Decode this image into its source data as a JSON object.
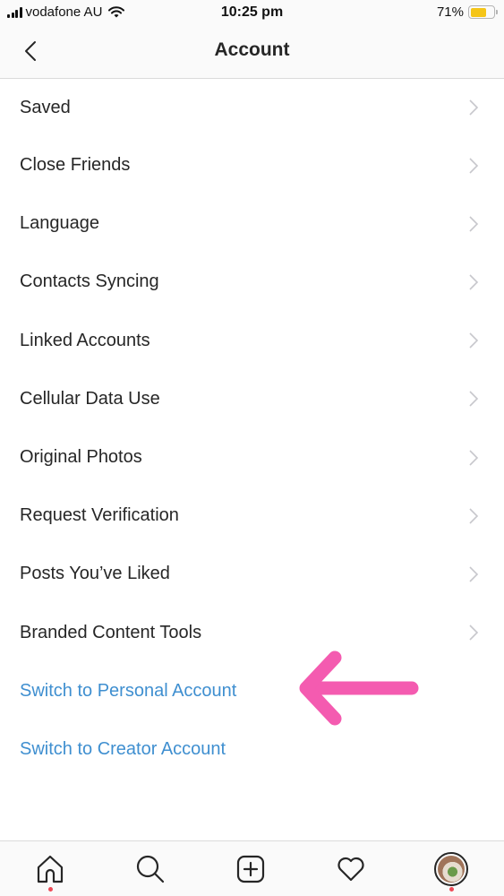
{
  "status_bar": {
    "carrier": "vodafone AU",
    "time": "10:25 pm",
    "battery_percent": "71%",
    "battery_level": 0.71,
    "battery_color": "#f5c518",
    "icons": [
      "signal-icon",
      "wifi-icon",
      "battery-icon"
    ]
  },
  "header": {
    "title": "Account",
    "back_icon": "chevron-left-icon"
  },
  "menu": {
    "items": [
      {
        "label": "Saved",
        "type": "nav"
      },
      {
        "label": "Close Friends",
        "type": "nav"
      },
      {
        "label": "Language",
        "type": "nav"
      },
      {
        "label": "Contacts Syncing",
        "type": "nav"
      },
      {
        "label": "Linked Accounts",
        "type": "nav"
      },
      {
        "label": "Cellular Data Use",
        "type": "nav"
      },
      {
        "label": "Original Photos",
        "type": "nav"
      },
      {
        "label": "Request Verification",
        "type": "nav"
      },
      {
        "label": "Posts You’ve Liked",
        "type": "nav"
      },
      {
        "label": "Branded Content Tools",
        "type": "nav"
      },
      {
        "label": "Switch to Personal Account",
        "type": "link"
      },
      {
        "label": "Switch to Creator Account",
        "type": "link"
      }
    ],
    "link_color": "#3f8fd0"
  },
  "annotation": {
    "icon": "arrow-left-icon",
    "color": "#f45bb0",
    "points_to": "Switch to Personal Account"
  },
  "tab_bar": {
    "tabs": [
      {
        "name": "home",
        "icon": "home-icon",
        "notification_dot": true
      },
      {
        "name": "search",
        "icon": "search-icon",
        "notification_dot": false
      },
      {
        "name": "new-post",
        "icon": "plus-square-icon",
        "notification_dot": false
      },
      {
        "name": "activity",
        "icon": "heart-icon",
        "notification_dot": false
      },
      {
        "name": "profile",
        "icon": "avatar",
        "notification_dot": true
      }
    ],
    "dot_color": "#ed4956"
  }
}
